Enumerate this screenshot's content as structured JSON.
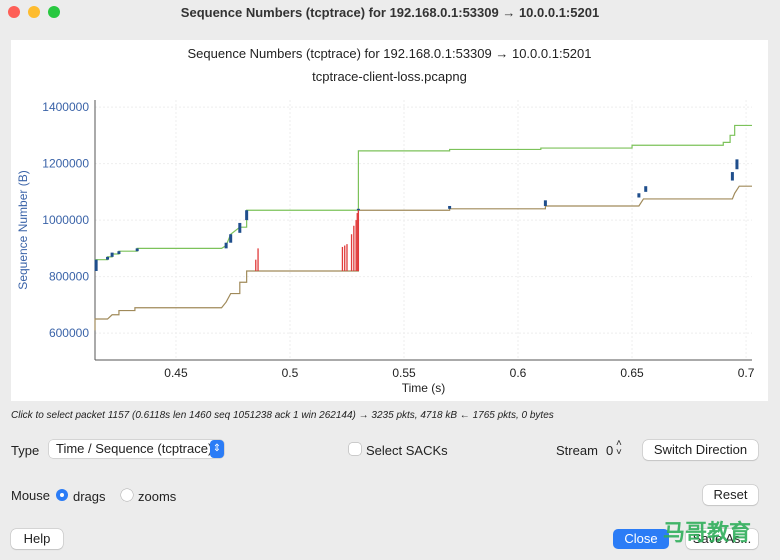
{
  "window": {
    "title": "Sequence Numbers (tcptrace) for 192.168.0.1:53309 → 10.0.0.1:5201"
  },
  "chart_title": "Sequence Numbers (tcptrace) for 192.168.0.1:53309 → 10.0.0.1:5201",
  "chart_subtitle": "tcptrace-client-loss.pcapng",
  "status": "Click to select packet 1157 (0.6118s len 1460 seq 1051238 ack 1 win 262144) → 3235 pkts, 4718 kB ← 1765 pkts, 0 bytes",
  "controls": {
    "type_label": "Type",
    "type_value": "Time / Sequence (tcptrace)",
    "select_sacks": "Select SACKs",
    "select_sacks_checked": false,
    "stream_label": "Stream",
    "stream_value": "0",
    "switch_direction": "Switch Direction",
    "mouse_label": "Mouse",
    "drags": "drags",
    "zooms": "zooms",
    "mouse_mode": "drags",
    "reset": "Reset",
    "help": "Help",
    "close": "Close",
    "save_as": "Save As..."
  },
  "watermark": "马哥教育",
  "colors": {
    "window": "#7cc25a",
    "ack": "#a08a5a",
    "segments": "#1f4e8c",
    "sack": "#e03a3a",
    "axis_label": "#3a63a8",
    "accent": "#2b7cf6"
  },
  "chart_data": {
    "type": "line",
    "xlabel": "Time (s)",
    "ylabel": "Sequence Number (B)",
    "xlim": [
      0.4145,
      0.7026
    ],
    "ylim": [
      505000,
      1425000
    ],
    "xticks": [
      0.45,
      0.5,
      0.55,
      0.6,
      0.65,
      0.7
    ],
    "yticks": [
      600000,
      800000,
      1000000,
      1200000,
      1400000
    ],
    "grid": true,
    "window_line": [
      [
        0.4145,
        860000
      ],
      [
        0.42,
        860000
      ],
      [
        0.42,
        870000
      ],
      [
        0.422,
        870000
      ],
      [
        0.422,
        880000
      ],
      [
        0.425,
        880000
      ],
      [
        0.425,
        890000
      ],
      [
        0.433,
        890000
      ],
      [
        0.433,
        900000
      ],
      [
        0.47,
        900000
      ],
      [
        0.472,
        910000
      ],
      [
        0.474,
        950000
      ],
      [
        0.478,
        975000
      ],
      [
        0.481,
        975000
      ],
      [
        0.481,
        1035000
      ],
      [
        0.53,
        1035000
      ],
      [
        0.53,
        1245000
      ],
      [
        0.57,
        1245000
      ],
      [
        0.57,
        1250000
      ],
      [
        0.61,
        1250000
      ],
      [
        0.61,
        1255000
      ],
      [
        0.65,
        1255000
      ],
      [
        0.65,
        1265000
      ],
      [
        0.69,
        1265000
      ],
      [
        0.69,
        1275000
      ],
      [
        0.693,
        1275000
      ],
      [
        0.693,
        1300000
      ],
      [
        0.695,
        1300000
      ],
      [
        0.695,
        1335000
      ],
      [
        0.7026,
        1335000
      ]
    ],
    "ack_line": [
      [
        0.4145,
        610000
      ],
      [
        0.4145,
        650000
      ],
      [
        0.42,
        650000
      ],
      [
        0.422,
        665000
      ],
      [
        0.425,
        665000
      ],
      [
        0.425,
        680000
      ],
      [
        0.432,
        680000
      ],
      [
        0.432,
        690000
      ],
      [
        0.47,
        690000
      ],
      [
        0.472,
        710000
      ],
      [
        0.474,
        740000
      ],
      [
        0.478,
        740000
      ],
      [
        0.478,
        780000
      ],
      [
        0.481,
        780000
      ],
      [
        0.481,
        820000
      ],
      [
        0.53,
        820000
      ],
      [
        0.53,
        1035000
      ],
      [
        0.57,
        1035000
      ],
      [
        0.57,
        1040000
      ],
      [
        0.612,
        1040000
      ],
      [
        0.612,
        1050000
      ],
      [
        0.653,
        1050000
      ],
      [
        0.655,
        1075000
      ],
      [
        0.694,
        1075000
      ],
      [
        0.695,
        1095000
      ],
      [
        0.697,
        1120000
      ],
      [
        0.7026,
        1120000
      ]
    ],
    "segments": [
      [
        0.415,
        820000,
        860000
      ],
      [
        0.42,
        860000,
        870000
      ],
      [
        0.422,
        870000,
        885000
      ],
      [
        0.425,
        880000,
        890000
      ],
      [
        0.433,
        890000,
        900000
      ],
      [
        0.472,
        900000,
        920000
      ],
      [
        0.474,
        920000,
        950000
      ],
      [
        0.478,
        955000,
        990000
      ],
      [
        0.481,
        1000000,
        1035000
      ],
      [
        0.53,
        1035000,
        1040000
      ],
      [
        0.57,
        1040000,
        1050000
      ],
      [
        0.612,
        1050000,
        1070000
      ],
      [
        0.653,
        1080000,
        1095000
      ],
      [
        0.656,
        1100000,
        1120000
      ],
      [
        0.694,
        1140000,
        1170000
      ],
      [
        0.696,
        1180000,
        1215000
      ]
    ],
    "sacks": [
      [
        0.485,
        820000,
        860000
      ],
      [
        0.486,
        820000,
        900000
      ],
      [
        0.523,
        820000,
        905000
      ],
      [
        0.524,
        820000,
        910000
      ],
      [
        0.525,
        820000,
        915000
      ],
      [
        0.527,
        820000,
        950000
      ],
      [
        0.528,
        820000,
        980000
      ],
      [
        0.529,
        820000,
        1000000
      ],
      [
        0.5295,
        820000,
        1025000
      ],
      [
        0.53,
        820000,
        1035000
      ]
    ]
  }
}
